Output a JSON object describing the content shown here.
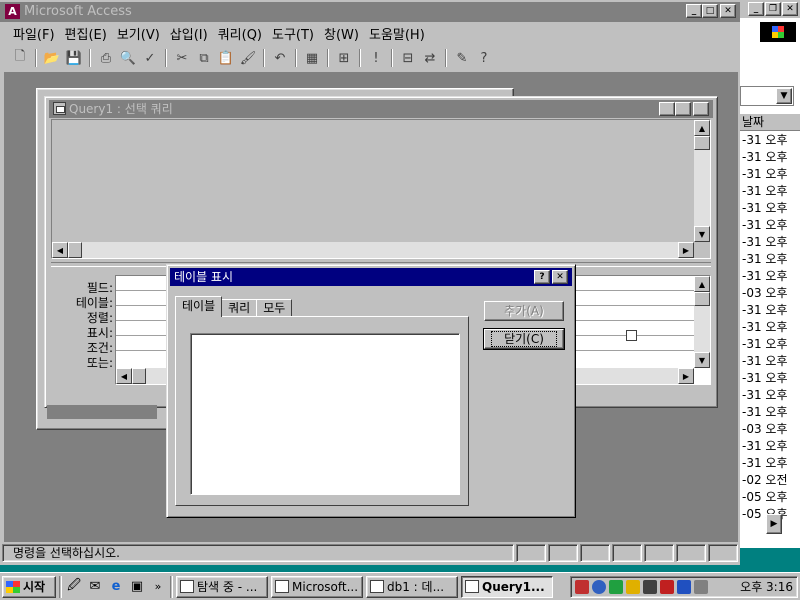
{
  "app": {
    "title": "Microsoft Access",
    "icon_label": "A",
    "menu": [
      "파일(F)",
      "편집(E)",
      "보기(V)",
      "삽입(I)",
      "쿼리(Q)",
      "도구(T)",
      "창(W)",
      "도움말(H)"
    ],
    "toolbar_icons": [
      "new-icon",
      "open-icon",
      "save-icon",
      "print-icon",
      "print-preview-icon",
      "spelling-icon",
      "cut-icon",
      "copy-icon",
      "paste-icon",
      "format-painter-icon",
      "undo-icon",
      "view-icon",
      "query-type-icon",
      "run-icon",
      "show-table-icon",
      "relationships-icon",
      "new-object-icon",
      "help-icon"
    ]
  },
  "query_window": {
    "title": "Query1 : 선택 쿼리",
    "grid_labels": [
      "필드:",
      "테이블:",
      "정렬:",
      "표시:",
      "조건:",
      "또는:"
    ]
  },
  "dialog": {
    "title": "테이블 표시",
    "help_label": "?",
    "tabs": [
      "테이블",
      "쿼리",
      "모두"
    ],
    "active_tab": "테이블",
    "add_label": "추가(A)",
    "close_label": "닫기(C)"
  },
  "status": {
    "text": "명령을 선택하십시오."
  },
  "background_window": {
    "header": "날짜",
    "rows": [
      "-31 오후",
      "-31 오후",
      "-31 오후",
      "-31 오후",
      "-31 오후",
      "-31 오후",
      "-31 오후",
      "-31 오후",
      "-31 오후",
      "-03 오후",
      "-31 오후",
      "-31 오후",
      "-31 오후",
      "-31 오후",
      "-31 오후",
      "-31 오후",
      "-31 오후",
      "-03 오후",
      "-31 오후",
      "-31 오후",
      "-02 오전",
      "-05 오후",
      "-05 오후"
    ]
  },
  "taskbar": {
    "start_label": "시작",
    "tasks": [
      {
        "label": "탐색 중 - ...",
        "active": false
      },
      {
        "label": "Microsoft...",
        "active": false
      },
      {
        "label": "db1 : 데...",
        "active": false
      },
      {
        "label": "Query1...",
        "active": true
      }
    ],
    "clock": "오후 3:16"
  },
  "colors": {
    "active_title": "#000080",
    "inactive_title": "#808080",
    "face": "#c0c0c0",
    "desktop": "#008080"
  }
}
